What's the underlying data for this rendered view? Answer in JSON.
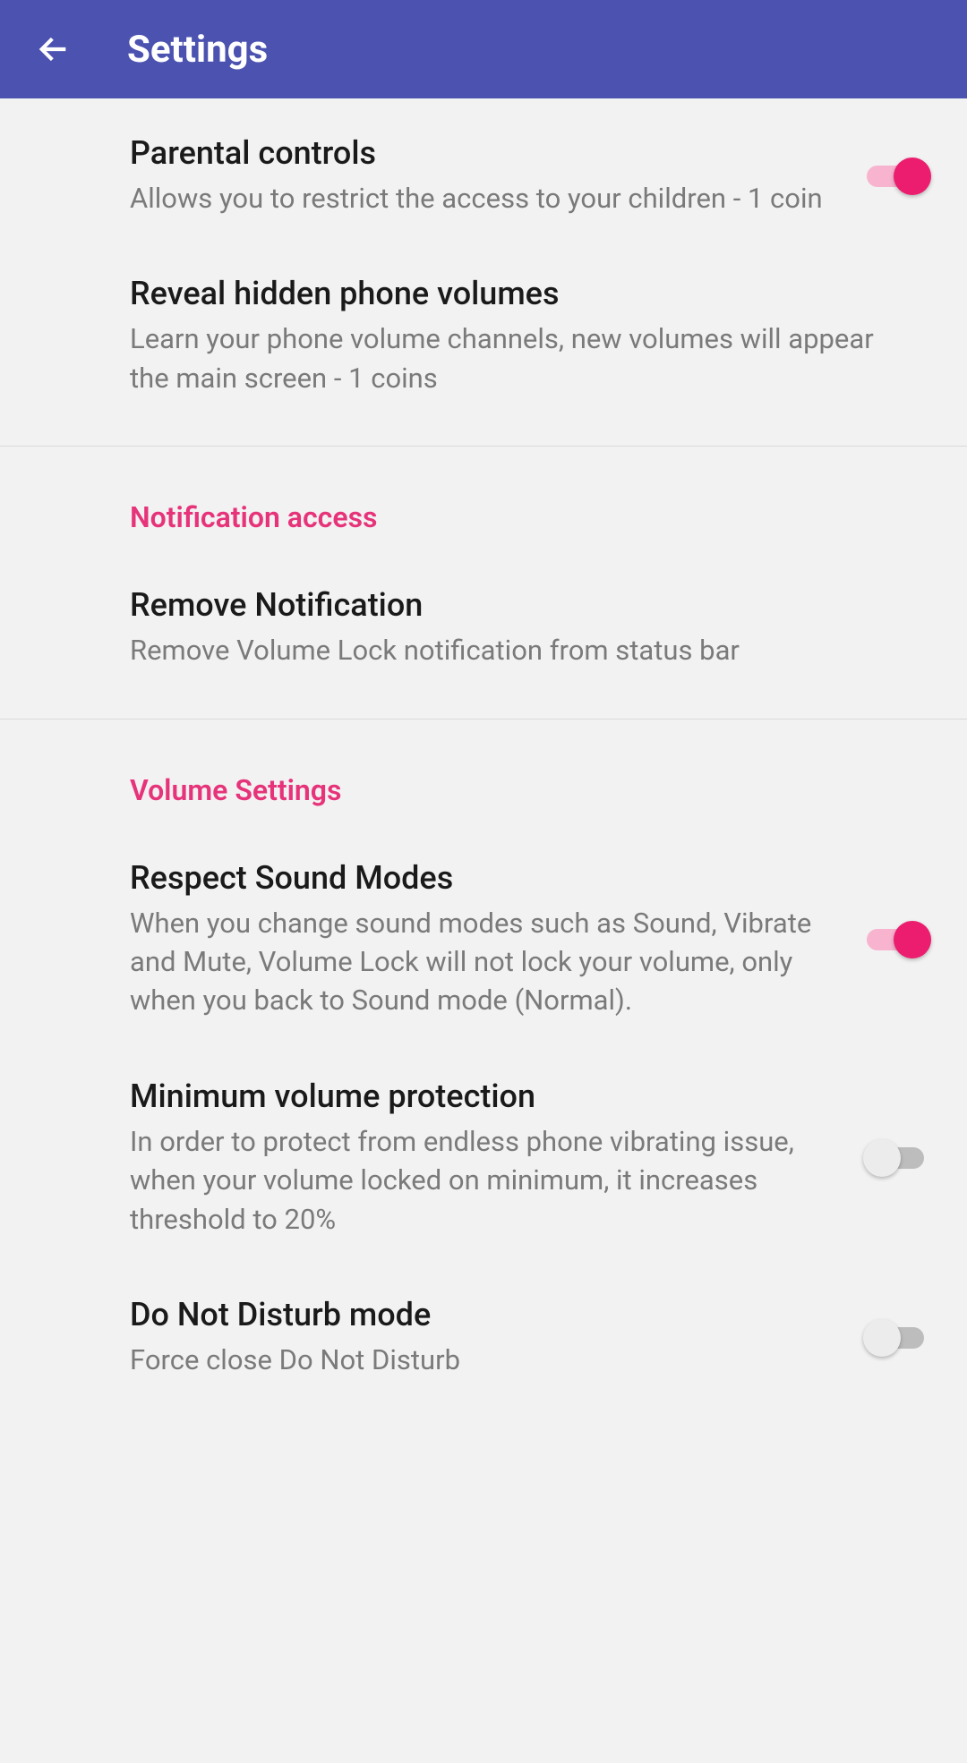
{
  "header": {
    "title": "Settings"
  },
  "colors": {
    "appbar": "#4b52b0",
    "accent": "#ec1c6e",
    "sectionHeader": "#e6337a"
  },
  "sections": [
    {
      "rows": [
        {
          "id": "parental-controls",
          "title": "Parental controls",
          "subtitle": "Allows you to restrict the access to your children - 1 coin",
          "toggle": true,
          "toggle_on": true
        },
        {
          "id": "reveal-hidden-volumes",
          "title": "Reveal hidden phone volumes",
          "subtitle": "Learn your phone volume channels, new volumes will appear the main screen - 1 coins",
          "toggle": false
        }
      ]
    },
    {
      "header": "Notification access",
      "rows": [
        {
          "id": "remove-notification",
          "title": "Remove Notification",
          "subtitle": "Remove Volume Lock notification from status bar",
          "toggle": false
        }
      ]
    },
    {
      "header": "Volume Settings",
      "rows": [
        {
          "id": "respect-sound-modes",
          "title": "Respect Sound Modes",
          "subtitle": "When you change sound modes such as Sound, Vibrate and Mute, Volume Lock will not lock your volume, only when you back to Sound mode (Normal).",
          "toggle": true,
          "toggle_on": true
        },
        {
          "id": "minimum-volume-protection",
          "title": "Minimum volume protection",
          "subtitle": "In order to protect from endless phone vibrating issue, when your volume locked on minimum, it increases threshold to 20%",
          "toggle": true,
          "toggle_on": false
        },
        {
          "id": "do-not-disturb",
          "title": "Do Not Disturb mode",
          "subtitle": "Force close Do Not Disturb",
          "toggle": true,
          "toggle_on": false
        }
      ]
    }
  ]
}
